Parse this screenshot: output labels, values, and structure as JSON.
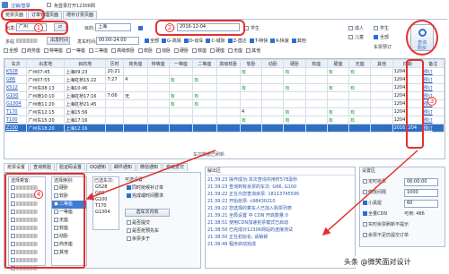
{
  "titlebar": {
    "login_label": "注销/登录",
    "ad_label": "免登录打开12306网"
  },
  "top_tabs": [
    "抢票页面",
    "订单管理页面",
    "增补订票页面"
  ],
  "search": {
    "from_label": "出发:",
    "from_value": "广州",
    "swap_symbol": "⇄",
    "to_label": "目的:",
    "to_value": "上海",
    "date_label": "日期:",
    "date_value": "2016-12-04",
    "student_label": "学生",
    "query_button": "查询",
    "buy_button": "购买"
  },
  "filters": {
    "from_label": "多站",
    "multi_label": "多站",
    "stations_placeholder": "出发时间",
    "time_label": "发车时间:",
    "time_value": "00:00-24:00",
    "train_types": [
      "全部",
      "G-高铁",
      "D-动车",
      "C-城际",
      "Z-直达",
      "T-特快",
      "K-快速",
      "其他"
    ]
  },
  "seat_type_checks": [
    "全部",
    "商务座",
    "特等座",
    "一等座",
    "二等座",
    "高级软卧",
    "软卧",
    "动卧",
    "硬卧",
    "软座",
    "硬座",
    "无座",
    "其他"
  ],
  "options": {
    "label_a": "成人",
    "label_b": "儿童",
    "label_c": "学生",
    "label_d": "全部",
    "sort_label": "车票预订"
  },
  "circles": [
    "1",
    "2",
    "3",
    "4"
  ],
  "table": {
    "headers": [
      "车次",
      "出发地",
      "目的地",
      "历时",
      "商务座",
      "特等座",
      "一等座",
      "二等座",
      "高级软卧",
      "软卧",
      "动卧",
      "硬卧",
      "软座",
      "硬座",
      "无座",
      "其他",
      "日期",
      "备注"
    ],
    "rows": [
      [
        "K528",
        "广州07:45",
        "上海09:23",
        "20:21",
        "",
        "",
        "",
        "",
        "",
        "有",
        "",
        "有",
        "",
        "有",
        "有",
        "",
        "1204",
        "预订"
      ],
      [
        "G66",
        "广州07:55",
        "上海虹桥15:22",
        "7:27",
        "4",
        "",
        "有",
        "有",
        "",
        "",
        "",
        "",
        "",
        "",
        "",
        "",
        "1204",
        "预订"
      ],
      [
        "K512",
        "广州东08:13",
        "上海10:46",
        "",
        "",
        "",
        "",
        "",
        "",
        "有",
        "",
        "有",
        "",
        "有",
        "有",
        "",
        "1204",
        "预订"
      ],
      [
        "G100",
        "广州南10:10",
        "上海虹桥17:16",
        "7:06",
        "无",
        "",
        "有",
        "有",
        "",
        "",
        "",
        "",
        "",
        "",
        "",
        "",
        "1204",
        "预订"
      ],
      [
        "G1304",
        "广州南11:20",
        "上海虹桥21:45",
        "",
        "",
        "",
        "有",
        "有",
        "",
        "",
        "",
        "",
        "",
        "",
        "",
        "",
        "1204",
        "预订"
      ],
      [
        "T170",
        "广州东12:15",
        "上海15:56",
        "",
        "",
        "",
        "",
        "",
        "",
        "4",
        "",
        "有",
        "",
        "有",
        "有",
        "",
        "1204",
        "预订"
      ],
      [
        "T100",
        "广州东15:20",
        "上海17:16",
        "",
        "",
        "",
        "",
        "",
        "",
        "有",
        "",
        "有",
        "",
        "有",
        "有",
        "",
        "1204",
        "预订"
      ],
      [
        "Z100",
        "广州东18:20",
        "上海12:16",
        "",
        "",
        "",
        "",
        "",
        "",
        "",
        "",
        "",
        "",
        "",
        "",
        "",
        "20161204",
        "预订"
      ]
    ],
    "footer": "车次数据已刷新"
  },
  "bottom_tabs": [
    "抢票设置",
    "查询校验",
    "验证码设置",
    "QQ通知",
    "邮件通知",
    "微信通知",
    "自动支付"
  ],
  "passengers": {
    "title": "选择乘客:",
    "rows": [
      "",
      "",
      "",
      "",
      "",
      "",
      "",
      "",
      "",
      "",
      ""
    ]
  },
  "seats": {
    "title": "选择席别:",
    "items": [
      "硬卧",
      "软卧",
      "二等座",
      "一等座",
      "无座",
      "软座",
      "动卧",
      "商务座",
      "其他"
    ]
  },
  "trains": {
    "title": "已选车次:",
    "items": [
      "G528",
      "G66",
      "G100",
      "T170",
      "G1304"
    ]
  },
  "mode": {
    "title": "可选设置",
    "items": [
      "同时抢候补订单",
      "完成或时间要求",
      "选项填写人数",
      "是否提交",
      "是否抢预先车",
      "余票多于"
    ],
    "button": "选车次内有"
  },
  "log": {
    "title": "解出区",
    "lines": [
      "21:39:23 操作成功:本次查询共用时578毫秒",
      "21:39:23 查询到有余票的车次: G66, G100",
      "21:39:22 正在为您查询余票: 18113745595",
      "21:39:22 开始抢票: c98430210",
      "21:39:22 您选择的乘车人已加入购票列表",
      "21:39:21 全局设置 中 CDN 开启数量:0",
      "21:38:51 使用CDN加速抢票模式已启动",
      "21:38:50 已完成对12306网站的连接测试",
      "21:38:50 正在初始化, 请稍候",
      "21:38:49 程序启动完成"
    ]
  },
  "settings": {
    "title": "设置区",
    "timer_label": "定时抢票",
    "timer_value": "06:00:00",
    "interval_label": "修改间隔",
    "interval_value": "1000",
    "small_label": "小黑屋",
    "small_value": "60",
    "cdn_label": "全量CDN",
    "cdn_value": "可用: 486",
    "opt1": "实时余票刷新不提示",
    "opt2": "余票不足仍提交订单"
  },
  "watermark": "头条 @微笑面对设计",
  "colors": {
    "accent": "#2f6fc6",
    "highlight_ring": "#e53030",
    "link": "#1a4fb5"
  }
}
